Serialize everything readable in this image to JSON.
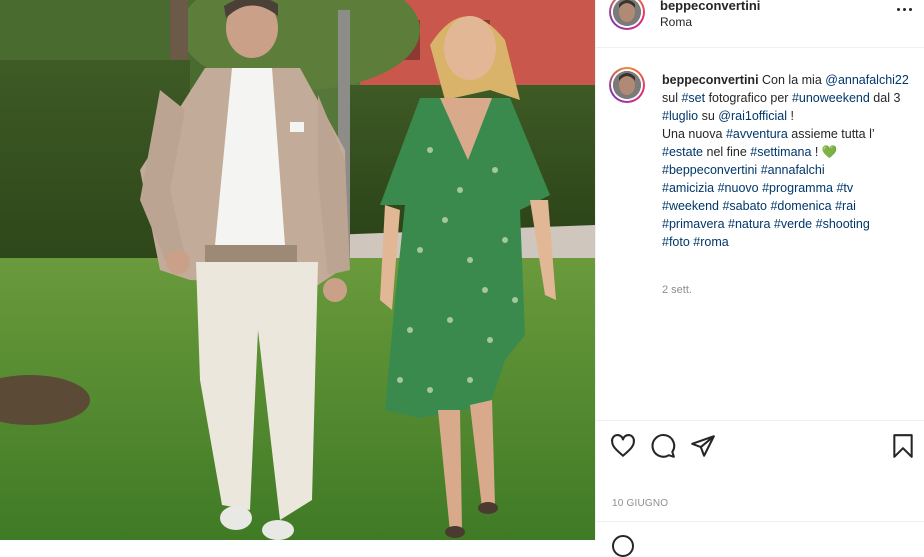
{
  "post": {
    "author": "beppeconvertini",
    "location": "Roma",
    "caption": {
      "author": "beppeconvertini",
      "parts": [
        {
          "t": " Con la mia ",
          "link": false
        },
        {
          "t": "@annafalchi22",
          "link": true
        },
        {
          "t": " sul ",
          "link": false
        },
        {
          "t": "#set",
          "link": true
        },
        {
          "t": " fotografico per ",
          "link": false
        },
        {
          "t": "#unoweekend",
          "link": true
        },
        {
          "t": " dal 3 ",
          "link": false
        },
        {
          "t": "#luglio",
          "link": true
        },
        {
          "t": " su ",
          "link": false
        },
        {
          "t": "@rai1official",
          "link": true
        },
        {
          "t": " !",
          "link": false
        },
        {
          "t": "\n",
          "link": false
        },
        {
          "t": "Una nuova ",
          "link": false
        },
        {
          "t": "#avventura",
          "link": true
        },
        {
          "t": " assieme tutta l’ ",
          "link": false
        },
        {
          "t": "#estate",
          "link": true
        },
        {
          "t": " nel fine ",
          "link": false
        },
        {
          "t": "#settimana",
          "link": true
        },
        {
          "t": " ! ",
          "link": false
        },
        {
          "t": "💚",
          "link": false
        },
        {
          "t": "\n",
          "link": false
        },
        {
          "t": "#beppeconvertini",
          "link": true
        },
        {
          "t": " ",
          "link": false
        },
        {
          "t": "#annafalchi",
          "link": true
        },
        {
          "t": "\n",
          "link": false
        },
        {
          "t": "#amicizia",
          "link": true
        },
        {
          "t": " ",
          "link": false
        },
        {
          "t": "#nuovo",
          "link": true
        },
        {
          "t": " ",
          "link": false
        },
        {
          "t": "#programma",
          "link": true
        },
        {
          "t": " ",
          "link": false
        },
        {
          "t": "#tv",
          "link": true
        },
        {
          "t": "\n",
          "link": false
        },
        {
          "t": "#weekend",
          "link": true
        },
        {
          "t": " ",
          "link": false
        },
        {
          "t": "#sabato",
          "link": true
        },
        {
          "t": " ",
          "link": false
        },
        {
          "t": "#domenica",
          "link": true
        },
        {
          "t": " ",
          "link": false
        },
        {
          "t": "#rai",
          "link": true
        },
        {
          "t": "\n",
          "link": false
        },
        {
          "t": "#primavera",
          "link": true
        },
        {
          "t": " ",
          "link": false
        },
        {
          "t": "#natura",
          "link": true
        },
        {
          "t": " ",
          "link": false
        },
        {
          "t": "#verde",
          "link": true
        },
        {
          "t": " ",
          "link": false
        },
        {
          "t": "#shooting",
          "link": true
        },
        {
          "t": "\n",
          "link": false
        },
        {
          "t": "#foto",
          "link": true
        },
        {
          "t": " ",
          "link": false
        },
        {
          "t": "#roma",
          "link": true
        }
      ]
    },
    "time_ago": "2 sett.",
    "date": "10 GIUGNO"
  },
  "icons": {
    "more": "more-options-icon",
    "like": "heart-icon",
    "comment": "comment-icon",
    "share": "paper-plane-icon",
    "save": "bookmark-icon",
    "emoji": "emoji-icon"
  },
  "colors": {
    "link": "#00376b",
    "text": "#262626",
    "muted": "#8e8e8e",
    "border": "#efefef"
  }
}
